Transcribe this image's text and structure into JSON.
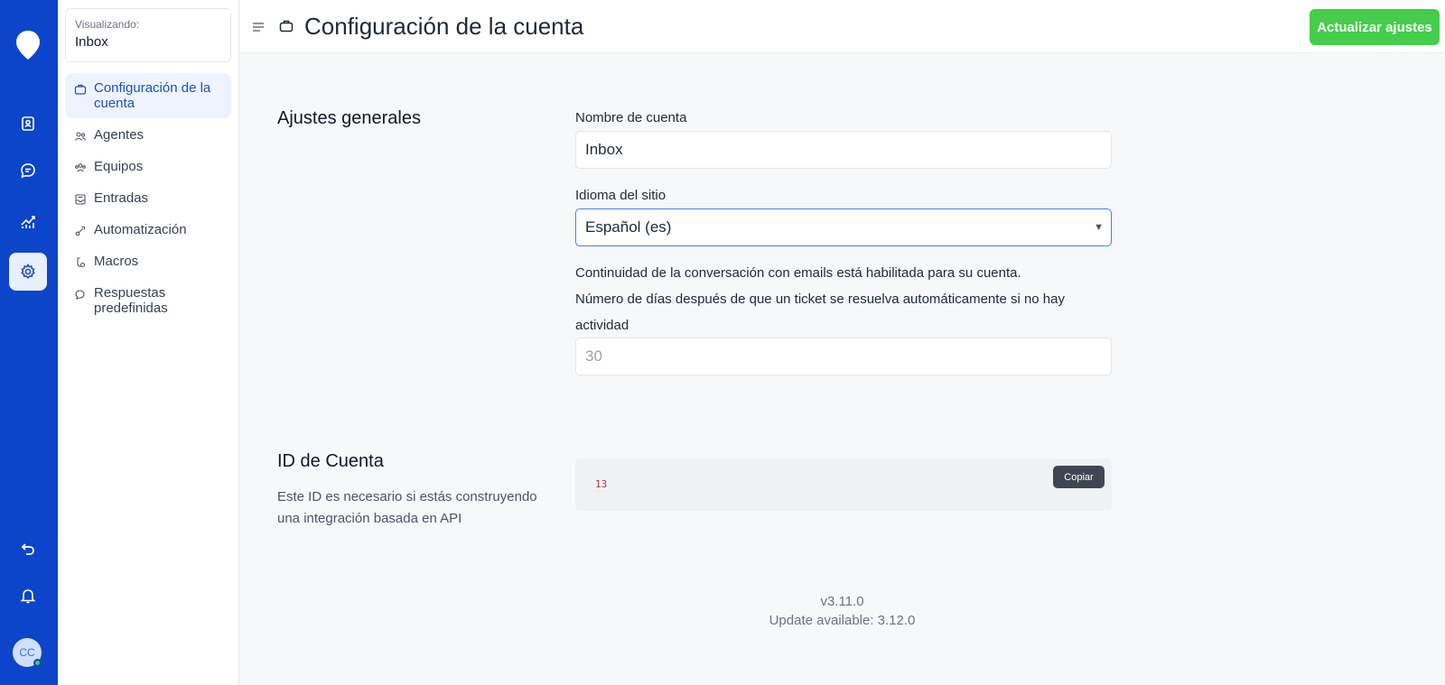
{
  "header": {
    "title": "Configuración de la cuenta",
    "update_button": "Actualizar ajustes"
  },
  "switcher": {
    "label": "Visualizando:",
    "value": "Inbox"
  },
  "sidebar": {
    "items": [
      {
        "label": "Configuración de la cuenta",
        "icon": "briefcase-icon",
        "active": true
      },
      {
        "label": "Agentes",
        "icon": "people-icon"
      },
      {
        "label": "Equipos",
        "icon": "teams-icon"
      },
      {
        "label": "Entradas",
        "icon": "inbox-icon"
      },
      {
        "label": "Automatización",
        "icon": "automation-icon"
      },
      {
        "label": "Macros",
        "icon": "macros-icon"
      },
      {
        "label": "Respuestas predefinidas",
        "icon": "chat-bubbles-icon"
      }
    ]
  },
  "rail": {
    "user_initials": "CC",
    "icons": [
      "logo-icon",
      "contacts-icon",
      "conversations-icon",
      "reports-icon",
      "settings-icon",
      "undo-icon",
      "bell-icon"
    ]
  },
  "general": {
    "title": "Ajustes generales",
    "account_name_label": "Nombre de cuenta",
    "account_name_value": "Inbox",
    "language_label": "Idioma del sitio",
    "language_value": "Español (es)",
    "continuity_text": "Continuidad de la conversación con emails está habilitada para su cuenta.",
    "auto_resolve_label": "Número de días después de que un ticket se resuelva automáticamente si no hay actividad",
    "auto_resolve_placeholder": "30"
  },
  "account_id": {
    "title": "ID de Cuenta",
    "description": "Este ID es necesario si estás construyendo una integración basada en API",
    "value": "13",
    "copy_button": "Copiar"
  },
  "footer": {
    "version": "v3.11.0",
    "update_available": "Update available: 3.12.0"
  },
  "colors": {
    "rail": "#0c45c9",
    "accent_green": "#44ce4b",
    "active_blue": "#1f4fb9"
  }
}
